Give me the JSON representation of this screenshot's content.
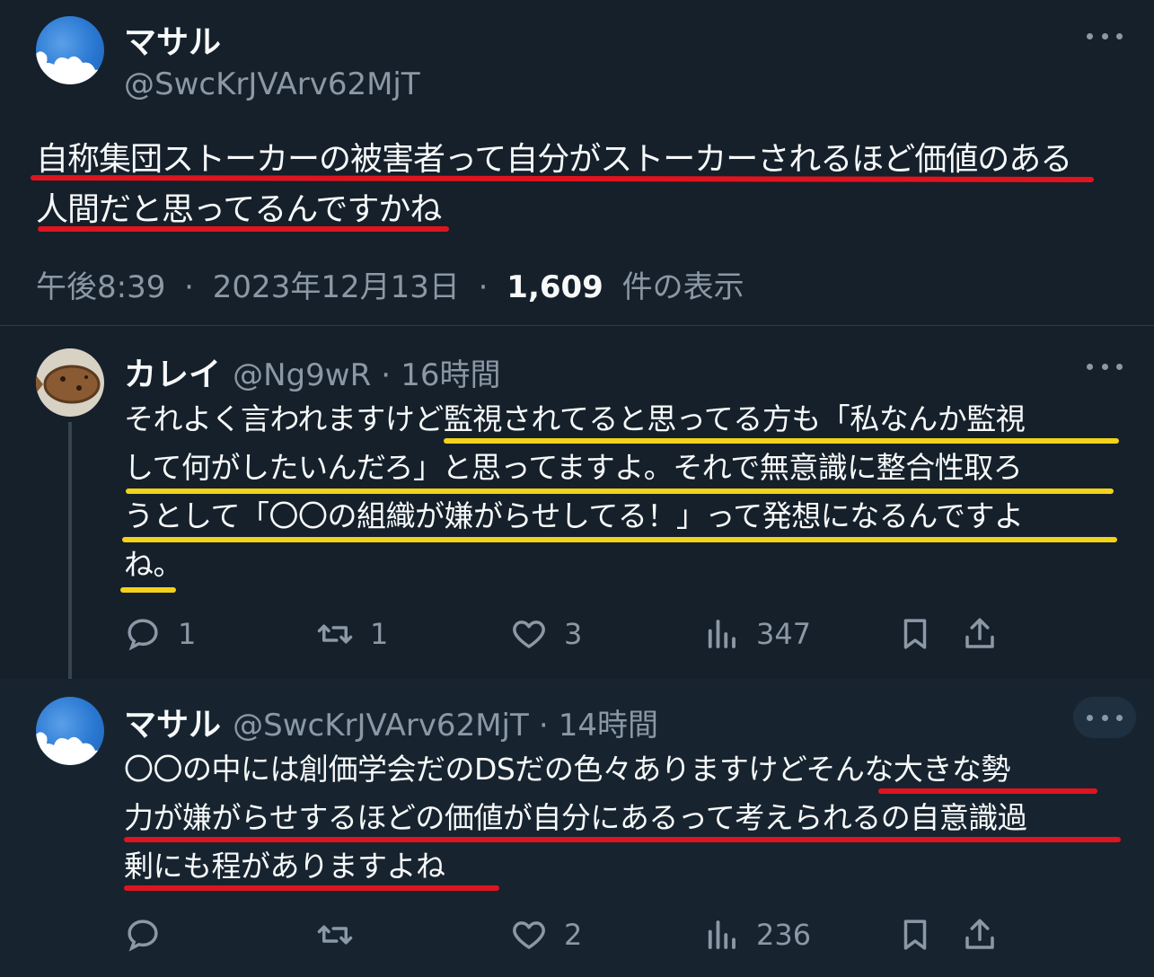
{
  "main_tweet": {
    "name": "マサル",
    "handle": "@SwcKrJVArv62MjT",
    "text_line1": "自称集団ストーカーの被害者って自分がストーカーされるほど価値のある",
    "text_line2": "人間だと思ってるんですかね",
    "time": "午後8:39",
    "date": "2023年12月13日",
    "views_count": "1,609",
    "views_label": "件の表示",
    "separator": "·",
    "avatar_icon": "sky-cloud-avatar-icon",
    "more_icon": "more-dots-icon"
  },
  "reply1": {
    "name": "カレイ",
    "handle": "@Ng9wR",
    "separator": "·",
    "time": "16時間",
    "text_line1": "それよく言われますけど監視されてると思ってる方も「私なんか監視",
    "text_line2": "して何がしたいんだろ」と思ってますよ。それで無意識に整合性取ろ",
    "text_line3": "うとして「〇〇の組織が嫌がらせしてる！」って発想になるんですよ",
    "text_line4": "ね。",
    "replies": "1",
    "retweets": "1",
    "likes": "3",
    "views": "347",
    "avatar_icon": "flatfish-avatar-icon"
  },
  "reply2": {
    "name": "マサル",
    "handle": "@SwcKrJVArv62MjT",
    "separator": "·",
    "time": "14時間",
    "text_line1": "〇〇の中には創価学会だのDSだの色々ありますけどそんな大きな勢",
    "text_line2": "力が嫌がらせするほどの価値が自分にあるって考えられるの自意識過",
    "text_line3": "剰にも程がありますよね",
    "replies": "",
    "retweets": "",
    "likes": "2",
    "views": "236",
    "avatar_icon": "sky-cloud-avatar-icon"
  },
  "colors": {
    "background": "#15202b",
    "text_primary": "#f7f9f9",
    "text_secondary": "#8b98a5",
    "highlight_red": "#e0141e",
    "highlight_yellow": "#f2d21b"
  }
}
